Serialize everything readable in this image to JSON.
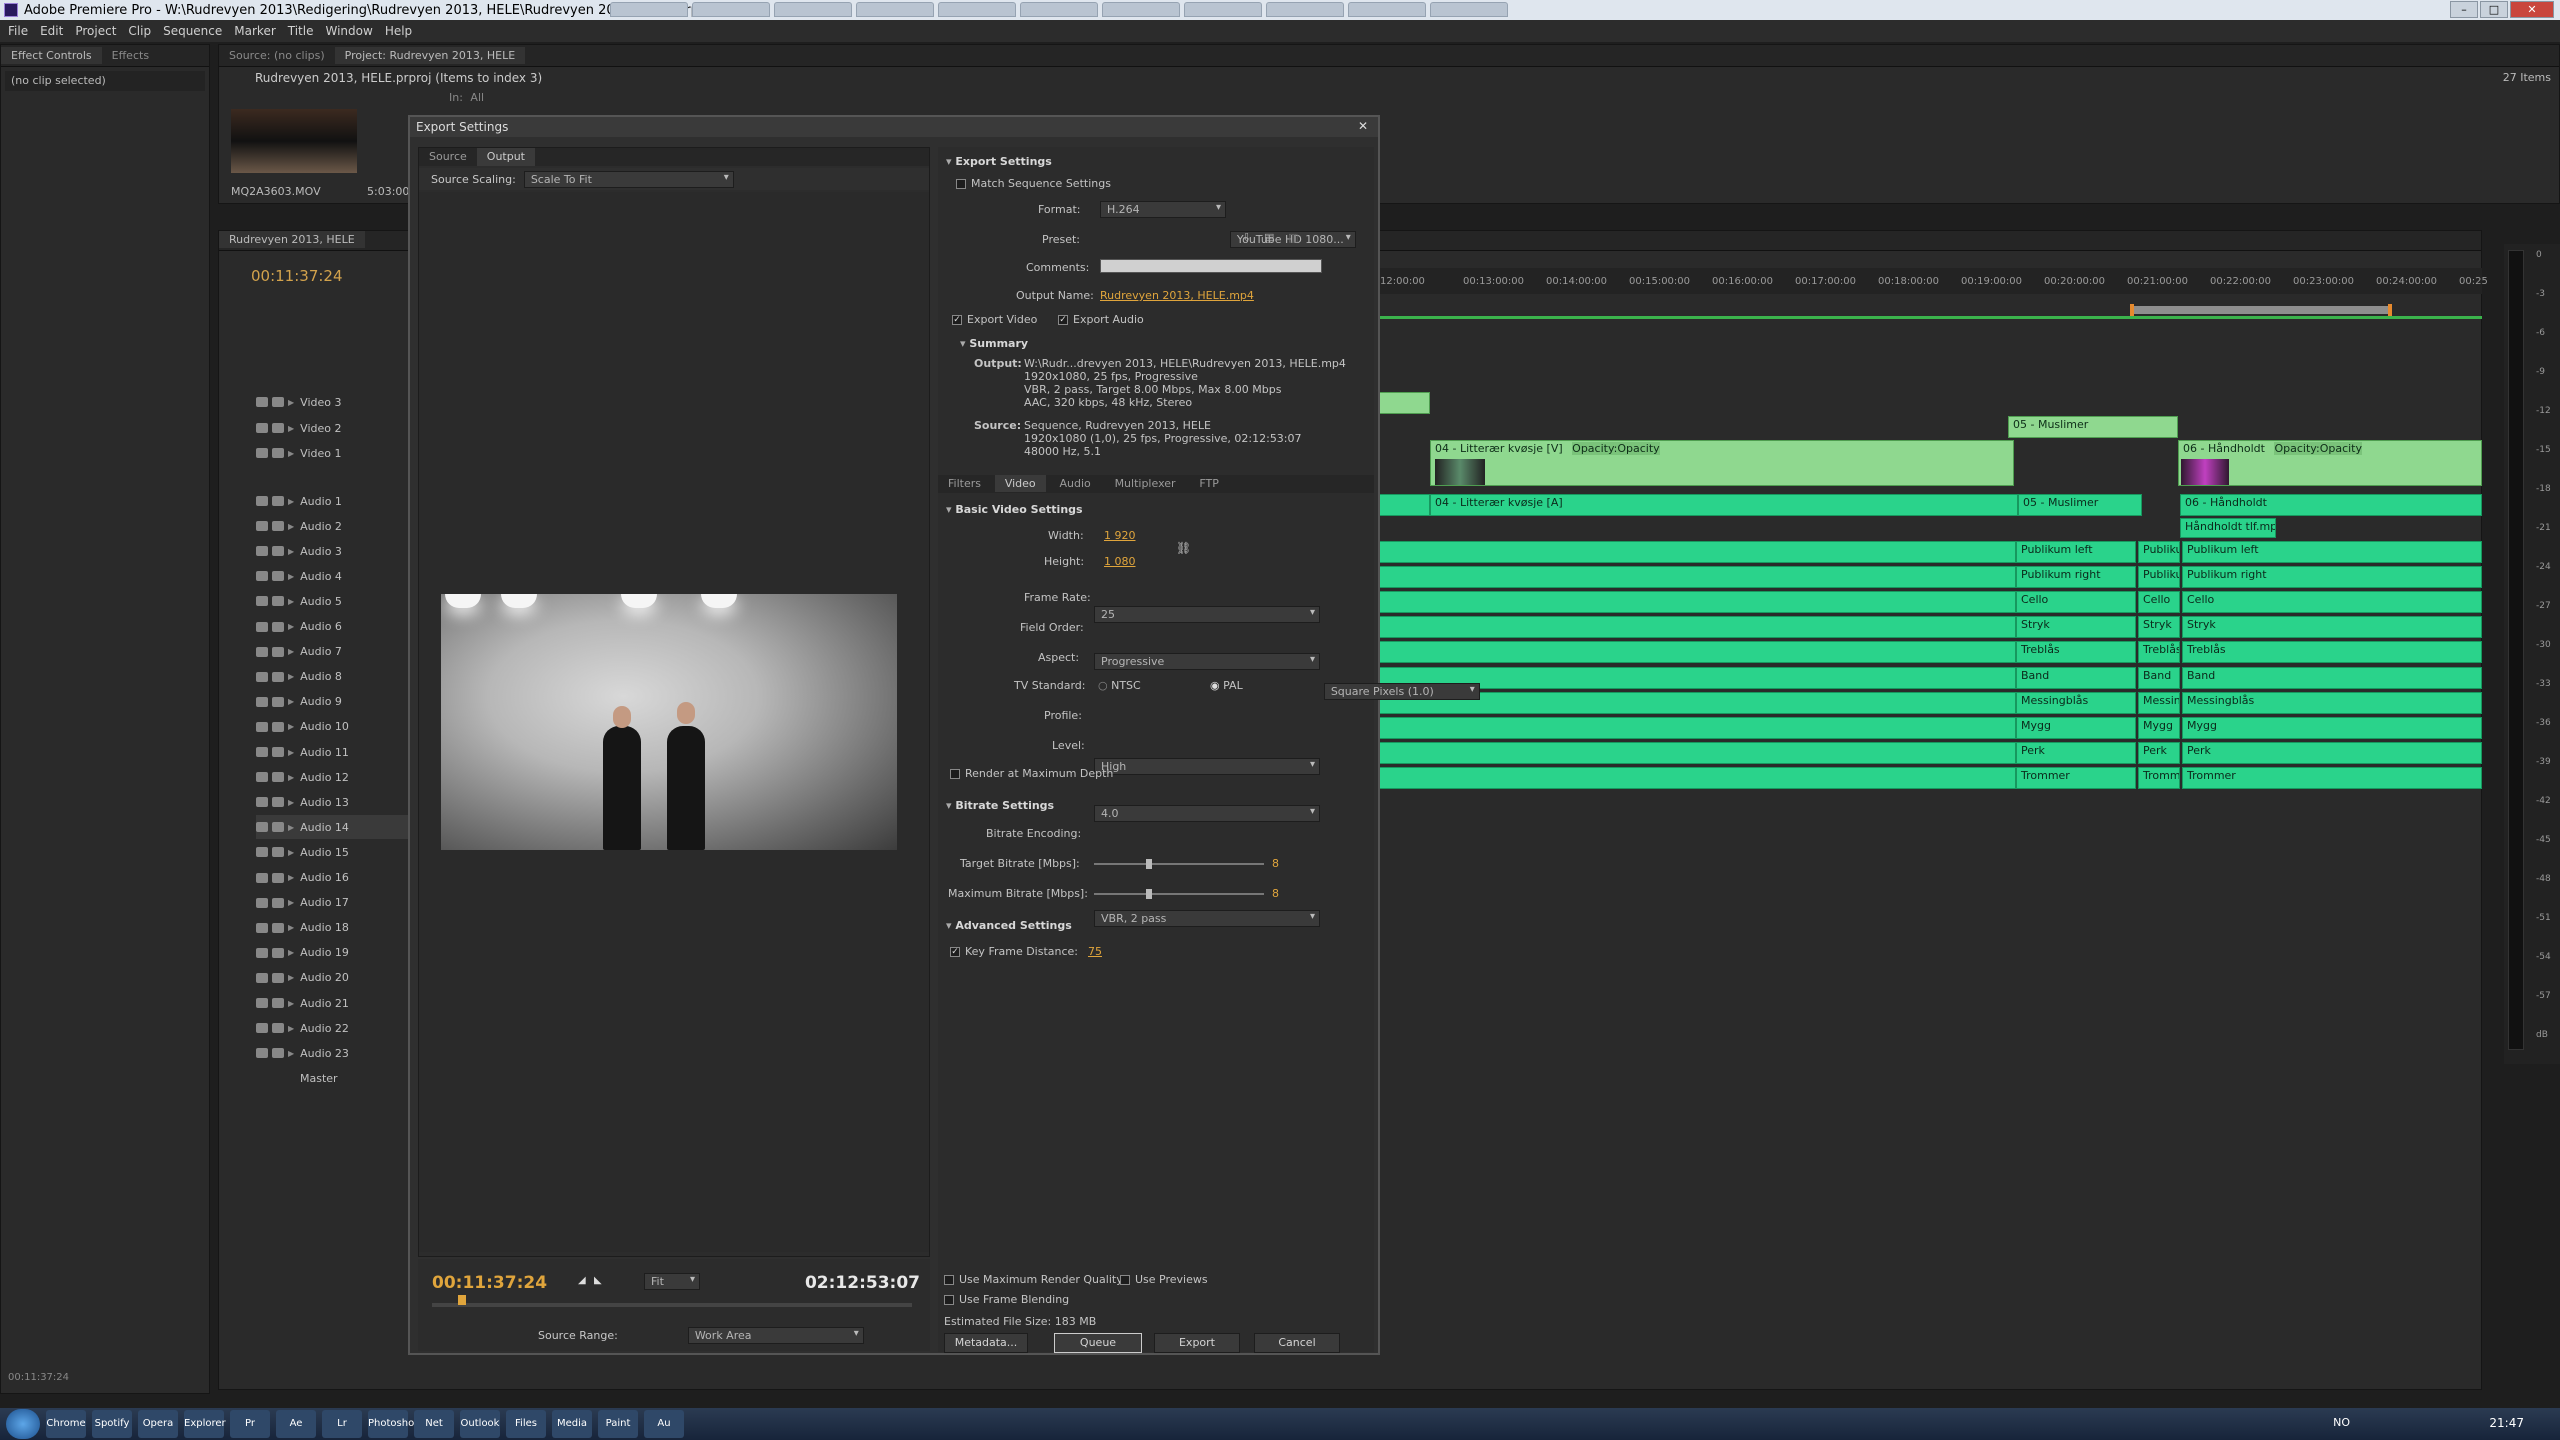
{
  "window": {
    "title": "Adobe Premiere Pro - W:\\Rudrevyen 2013\\Redigering\\Rudrevyen 2013, HELE\\Rudrevyen 2013, HELE.prproj"
  },
  "menu": [
    "File",
    "Edit",
    "Project",
    "Clip",
    "Sequence",
    "Marker",
    "Title",
    "Window",
    "Help"
  ],
  "left_panel": {
    "tabs": [
      "Effect Controls",
      "Effects"
    ],
    "content": "(no clip selected)",
    "status_timecode": "00:11:37:24"
  },
  "project_panel": {
    "tabs": [
      "Source: (no clips)",
      "Project: Rudrevyen 2013, HELE"
    ],
    "title": "Rudrevyen 2013, HELE.prproj (Items to index 3)",
    "items_count": "27 Items",
    "in_label": "In:",
    "in_value": "All",
    "thumb_name": "MQ2A3603.MOV",
    "thumb_duration": "5:03:00"
  },
  "timeline": {
    "tab": "Rudrevyen 2013, HELE",
    "timecode": "00:11:37:24",
    "ruler": [
      "12:00:00",
      "00:13:00:00",
      "00:14:00:00",
      "00:15:00:00",
      "00:16:00:00",
      "00:17:00:00",
      "00:18:00:00",
      "00:19:00:00",
      "00:20:00:00",
      "00:21:00:00",
      "00:22:00:00",
      "00:23:00:00",
      "00:24:00:00",
      "00:25"
    ],
    "video_tracks": [
      "Video 3",
      "Video 2",
      "Video 1"
    ],
    "audio_tracks": [
      "Audio 1",
      "Audio 2",
      "Audio 3",
      "Audio 4",
      "Audio 5",
      "Audio 6",
      "Audio 7",
      "Audio 8",
      "Audio 9",
      "Audio 10",
      "Audio 11",
      "Audio 12",
      "Audio 13",
      "Audio 14",
      "Audio 15",
      "Audio 16",
      "Audio 17",
      "Audio 18",
      "Audio 19",
      "Audio 20",
      "Audio 21",
      "Audio 22",
      "Audio 23"
    ],
    "master": "Master",
    "selected_track": "Audio 14",
    "clips": {
      "v2_a": "05 - Muslimer",
      "v1_a": "04 - Litterær kvøsje [V]",
      "v1_a_opacity": "Opacity:Opacity",
      "v1_b": "06 - Håndholdt",
      "v1_b_opacity": "Opacity:Opacity",
      "a1_a": "04 - Litterær kvøsje [A]",
      "a1_b": "05 - Muslimer",
      "a1_c": "06 - Håndholdt",
      "a2_c": "Håndholdt tlf.mp3",
      "audio_names": [
        "Publikum left",
        "Publikum right",
        "Cello",
        "Stryk",
        "Treblås",
        "Band",
        "Messingblås",
        "Mygg",
        "Perk",
        "Trommer"
      ],
      "audio_names_short": [
        "Publikum",
        "Publikum",
        "Cello",
        "Stryk",
        "Treblås",
        "Band",
        "Messin",
        "Mygg",
        "Perk",
        "Tromm"
      ]
    }
  },
  "vu_meter": {
    "labels": [
      "0",
      "-3",
      "-6",
      "-9",
      "-12",
      "-15",
      "-18",
      "-21",
      "-24",
      "-27",
      "-30",
      "-33",
      "-36",
      "-39",
      "-42",
      "-45",
      "-48",
      "-51",
      "-54",
      "-57",
      "dB"
    ]
  },
  "dialog": {
    "title": "Export Settings",
    "preview_tabs": [
      "Source",
      "Output"
    ],
    "source_scaling_label": "Source Scaling:",
    "source_scaling_value": "Scale To Fit",
    "current_timecode": "00:11:37:24",
    "end_timecode": "02:12:53:07",
    "fit_value": "Fit",
    "source_range_label": "Source Range:",
    "source_range_value": "Work Area",
    "export_settings_header": "Export Settings",
    "match_sequence": "Match Sequence Settings",
    "format_label": "Format:",
    "format_value": "H.264",
    "preset_label": "Preset:",
    "preset_value": "YouTube HD 1080...",
    "comments_label": "Comments:",
    "output_name_label": "Output Name:",
    "output_name_value": "Rudrevyen 2013, HELE.mp4",
    "export_video": "Export Video",
    "export_audio": "Export Audio",
    "summary_header": "Summary",
    "summary_output_label": "Output:",
    "summary_output_lines": [
      "W:\\Rudr...drevyen 2013, HELE\\Rudrevyen 2013, HELE.mp4",
      "1920x1080, 25 fps, Progressive",
      "VBR, 2 pass, Target 8.00 Mbps, Max 8.00 Mbps",
      "AAC, 320 kbps, 48 kHz, Stereo"
    ],
    "summary_source_label": "Source:",
    "summary_source_lines": [
      "Sequence, Rudrevyen 2013, HELE",
      "1920x1080 (1,0), 25 fps, Progressive, 02:12:53:07",
      "48000 Hz, 5.1"
    ],
    "settings_tabs": [
      "Filters",
      "Video",
      "Audio",
      "Multiplexer",
      "FTP"
    ],
    "basic_video_header": "Basic Video Settings",
    "width_label": "Width:",
    "width_value": "1 920",
    "height_label": "Height:",
    "height_value": "1 080",
    "frame_rate_label": "Frame Rate:",
    "frame_rate_value": "25",
    "field_order_label": "Field Order:",
    "field_order_value": "Progressive",
    "aspect_label": "Aspect:",
    "aspect_value": "Square Pixels (1.0)",
    "tv_standard_label": "TV Standard:",
    "tv_ntsc": "NTSC",
    "tv_pal": "PAL",
    "profile_label": "Profile:",
    "profile_value": "High",
    "level_label": "Level:",
    "level_value": "4.0",
    "render_max_depth": "Render at Maximum Depth",
    "bitrate_header": "Bitrate Settings",
    "bitrate_encoding_label": "Bitrate Encoding:",
    "bitrate_encoding_value": "VBR, 2 pass",
    "target_bitrate_label": "Target Bitrate [Mbps]:",
    "target_bitrate_value": "8",
    "max_bitrate_label": "Maximum Bitrate [Mbps]:",
    "max_bitrate_value": "8",
    "advanced_header": "Advanced Settings",
    "key_frame_label": "Key Frame Distance:",
    "key_frame_value": "75",
    "use_max_render": "Use Maximum Render Quality",
    "use_previews": "Use Previews",
    "use_frame_blending": "Use Frame Blending",
    "estimated_size": "Estimated File Size: 183 MB",
    "btn_metadata": "Metadata...",
    "btn_queue": "Queue",
    "btn_export": "Export",
    "btn_cancel": "Cancel"
  },
  "taskbar": {
    "apps": [
      "Chrome",
      "Spotify",
      "Opera",
      "Explorer",
      "Pr",
      "Ae",
      "Lr",
      "Photoshop",
      "Net",
      "Outlook",
      "Files",
      "Media",
      "Paint",
      "Au"
    ],
    "language": "NO",
    "clock": "21:47"
  }
}
